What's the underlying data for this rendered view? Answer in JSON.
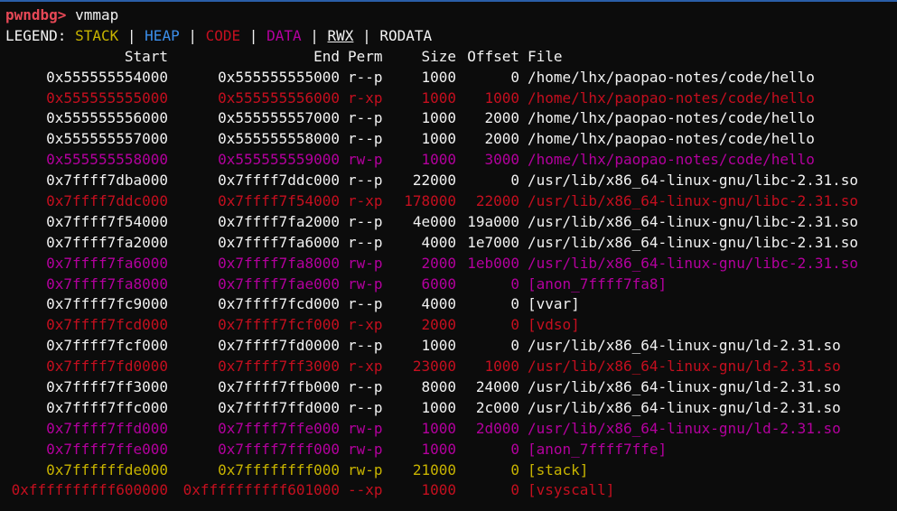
{
  "colors": {
    "background": "#0c0c0c",
    "text": "#f2f2f2",
    "prompt": "#e74856",
    "stack": "#c8b400",
    "heap": "#3b8eea",
    "code": "#c50f1f",
    "data": "#b4009e",
    "rwx": "#f2f2f2",
    "rodata": "#f2f2f2",
    "accent_bar": "#2a5ea8"
  },
  "prompt": {
    "name": "pwndbg>",
    "command": "vmmap"
  },
  "legend": {
    "label": "LEGEND:",
    "sep": "|",
    "stack": "STACK",
    "heap": "HEAP",
    "code": "CODE",
    "data": "DATA",
    "rwx": "RWX",
    "rodata": "RODATA"
  },
  "table": {
    "headers": {
      "start": "Start",
      "end": "End",
      "perm": "Perm",
      "size": "Size",
      "offset": "Offset",
      "file": "File"
    },
    "rows": [
      {
        "start": "0x555555554000",
        "end": "0x555555555000",
        "perm": "r--p",
        "size": "1000",
        "offset": "0",
        "file": "/home/lhx/paopao-notes/code/hello",
        "kind": "rodata"
      },
      {
        "start": "0x555555555000",
        "end": "0x555555556000",
        "perm": "r-xp",
        "size": "1000",
        "offset": "1000",
        "file": "/home/lhx/paopao-notes/code/hello",
        "kind": "code"
      },
      {
        "start": "0x555555556000",
        "end": "0x555555557000",
        "perm": "r--p",
        "size": "1000",
        "offset": "2000",
        "file": "/home/lhx/paopao-notes/code/hello",
        "kind": "rodata"
      },
      {
        "start": "0x555555557000",
        "end": "0x555555558000",
        "perm": "r--p",
        "size": "1000",
        "offset": "2000",
        "file": "/home/lhx/paopao-notes/code/hello",
        "kind": "rodata"
      },
      {
        "start": "0x555555558000",
        "end": "0x555555559000",
        "perm": "rw-p",
        "size": "1000",
        "offset": "3000",
        "file": "/home/lhx/paopao-notes/code/hello",
        "kind": "data"
      },
      {
        "start": "0x7ffff7dba000",
        "end": "0x7ffff7ddc000",
        "perm": "r--p",
        "size": "22000",
        "offset": "0",
        "file": "/usr/lib/x86_64-linux-gnu/libc-2.31.so",
        "kind": "rodata"
      },
      {
        "start": "0x7ffff7ddc000",
        "end": "0x7ffff7f54000",
        "perm": "r-xp",
        "size": "178000",
        "offset": "22000",
        "file": "/usr/lib/x86_64-linux-gnu/libc-2.31.so",
        "kind": "code"
      },
      {
        "start": "0x7ffff7f54000",
        "end": "0x7ffff7fa2000",
        "perm": "r--p",
        "size": "4e000",
        "offset": "19a000",
        "file": "/usr/lib/x86_64-linux-gnu/libc-2.31.so",
        "kind": "rodata"
      },
      {
        "start": "0x7ffff7fa2000",
        "end": "0x7ffff7fa6000",
        "perm": "r--p",
        "size": "4000",
        "offset": "1e7000",
        "file": "/usr/lib/x86_64-linux-gnu/libc-2.31.so",
        "kind": "rodata"
      },
      {
        "start": "0x7ffff7fa6000",
        "end": "0x7ffff7fa8000",
        "perm": "rw-p",
        "size": "2000",
        "offset": "1eb000",
        "file": "/usr/lib/x86_64-linux-gnu/libc-2.31.so",
        "kind": "data"
      },
      {
        "start": "0x7ffff7fa8000",
        "end": "0x7ffff7fae000",
        "perm": "rw-p",
        "size": "6000",
        "offset": "0",
        "file": "[anon_7ffff7fa8]",
        "kind": "data"
      },
      {
        "start": "0x7ffff7fc9000",
        "end": "0x7ffff7fcd000",
        "perm": "r--p",
        "size": "4000",
        "offset": "0",
        "file": "[vvar]",
        "kind": "rodata"
      },
      {
        "start": "0x7ffff7fcd000",
        "end": "0x7ffff7fcf000",
        "perm": "r-xp",
        "size": "2000",
        "offset": "0",
        "file": "[vdso]",
        "kind": "code"
      },
      {
        "start": "0x7ffff7fcf000",
        "end": "0x7ffff7fd0000",
        "perm": "r--p",
        "size": "1000",
        "offset": "0",
        "file": "/usr/lib/x86_64-linux-gnu/ld-2.31.so",
        "kind": "rodata"
      },
      {
        "start": "0x7ffff7fd0000",
        "end": "0x7ffff7ff3000",
        "perm": "r-xp",
        "size": "23000",
        "offset": "1000",
        "file": "/usr/lib/x86_64-linux-gnu/ld-2.31.so",
        "kind": "code"
      },
      {
        "start": "0x7ffff7ff3000",
        "end": "0x7ffff7ffb000",
        "perm": "r--p",
        "size": "8000",
        "offset": "24000",
        "file": "/usr/lib/x86_64-linux-gnu/ld-2.31.so",
        "kind": "rodata"
      },
      {
        "start": "0x7ffff7ffc000",
        "end": "0x7ffff7ffd000",
        "perm": "r--p",
        "size": "1000",
        "offset": "2c000",
        "file": "/usr/lib/x86_64-linux-gnu/ld-2.31.so",
        "kind": "rodata"
      },
      {
        "start": "0x7ffff7ffd000",
        "end": "0x7ffff7ffe000",
        "perm": "rw-p",
        "size": "1000",
        "offset": "2d000",
        "file": "/usr/lib/x86_64-linux-gnu/ld-2.31.so",
        "kind": "data"
      },
      {
        "start": "0x7ffff7ffe000",
        "end": "0x7ffff7fff000",
        "perm": "rw-p",
        "size": "1000",
        "offset": "0",
        "file": "[anon_7ffff7ffe]",
        "kind": "data"
      },
      {
        "start": "0x7ffffffde000",
        "end": "0x7ffffffff000",
        "perm": "rw-p",
        "size": "21000",
        "offset": "0",
        "file": "[stack]",
        "kind": "stack"
      },
      {
        "start": "0xffffffffff600000",
        "end": "0xffffffffff601000",
        "perm": "--xp",
        "size": "1000",
        "offset": "0",
        "file": "[vsyscall]",
        "kind": "code"
      }
    ]
  }
}
